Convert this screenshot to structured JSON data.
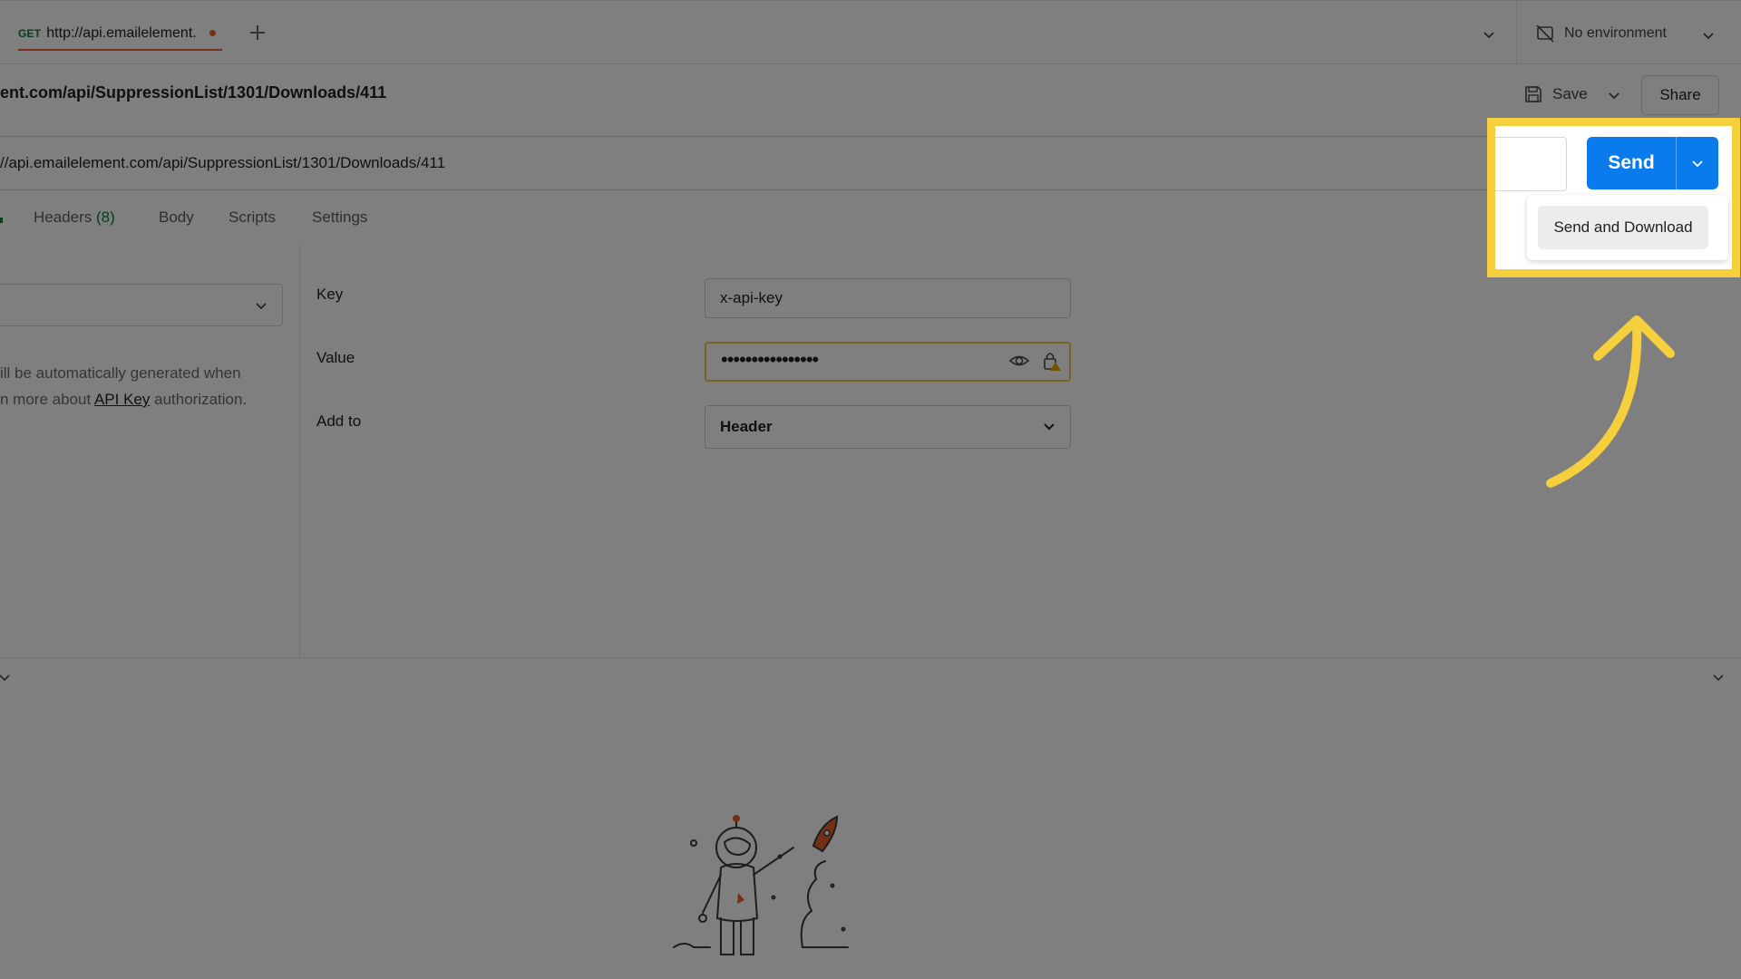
{
  "tab": {
    "method": "GET",
    "name": "http://api.emailelement.",
    "unsaved": true
  },
  "environment": {
    "label": "No environment"
  },
  "request": {
    "title": "ent.com/api/SuppressionList/1301/Downloads/411",
    "url": "//api.emailelement.com/api/SuppressionList/1301/Downloads/411"
  },
  "toolbar": {
    "save_label": "Save",
    "share_label": "Share"
  },
  "request_tabs": {
    "headers_label": "Headers",
    "headers_count": "(8)",
    "body_label": "Body",
    "scripts_label": "Scripts",
    "settings_label": "Settings"
  },
  "auth": {
    "description_line1": "ill be automatically generated when",
    "description_line2_prefix": "n more about ",
    "description_link": "API Key",
    "description_line2_suffix": " authorization.",
    "key_label": "Key",
    "key_value": "x-api-key",
    "value_label": "Value",
    "value_masked": "••••••••••••••••",
    "addto_label": "Add to",
    "addto_value": "Header"
  },
  "send": {
    "label": "Send",
    "menu_item": "Send and Download"
  },
  "colors": {
    "accent_orange": "#e8612c",
    "method_green": "#0c7a3e",
    "send_blue": "#097bed",
    "highlight_yellow": "#f6cf3d"
  }
}
